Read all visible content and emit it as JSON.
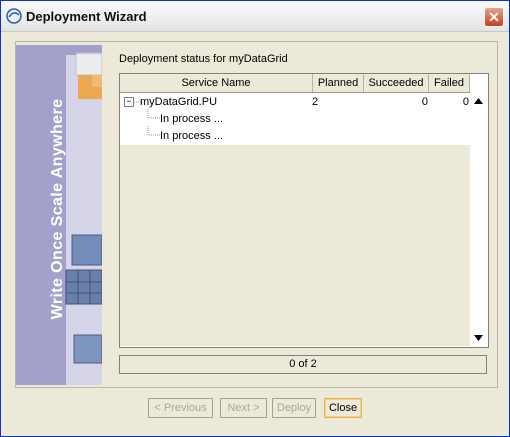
{
  "window": {
    "title": "Deployment Wizard"
  },
  "banner": {
    "text": "Write Once Scale Anywhere"
  },
  "status": {
    "label": "Deployment status for myDataGrid"
  },
  "table": {
    "headers": [
      "Service Name",
      "Planned",
      "Succeeded",
      "Failed"
    ],
    "rows": [
      {
        "name": "myDataGrid.PU",
        "planned": "2",
        "succeeded": "0",
        "failed": "0"
      },
      {
        "name": "In process ..."
      },
      {
        "name": "In process ..."
      }
    ]
  },
  "progress": {
    "text": "0 of 2"
  },
  "buttons": {
    "previous": "< Previous",
    "next": "Next >",
    "deploy": "Deploy",
    "close": "Close"
  },
  "colors": {
    "title_bar": "#f0f0f0",
    "banner": "#a3a1cc",
    "close_accent": "#e6b157"
  }
}
